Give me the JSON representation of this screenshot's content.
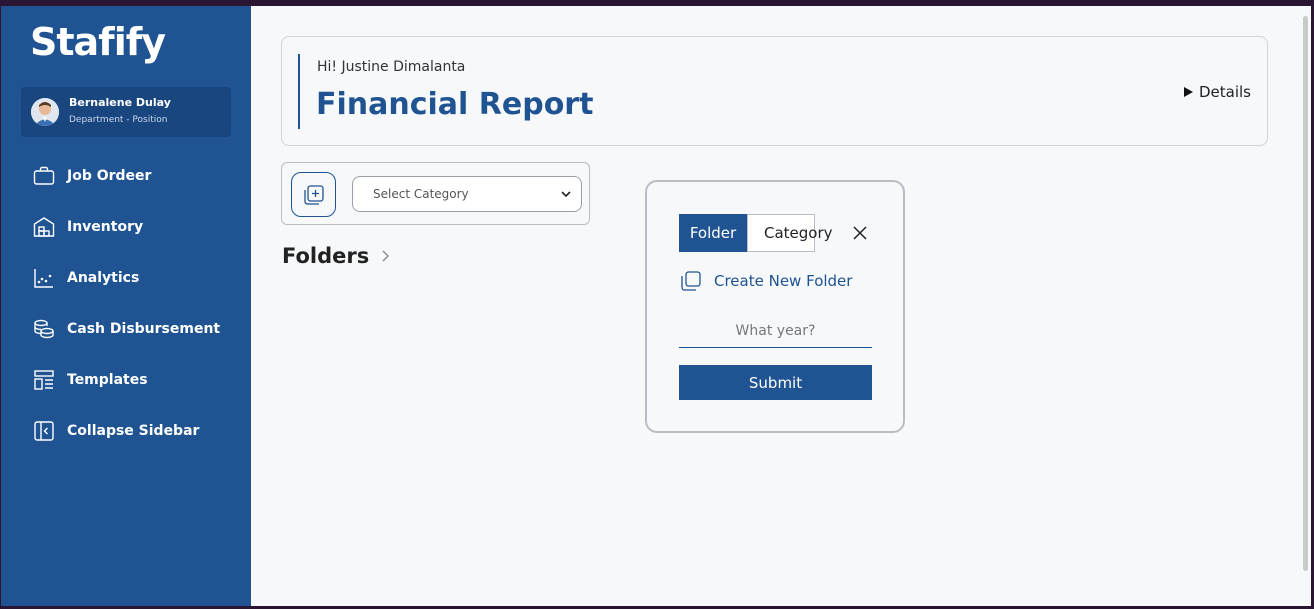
{
  "app": {
    "logo": "Stafify"
  },
  "profile": {
    "name": "Bernalene Dulay",
    "role": "Department - Position"
  },
  "sidebar": {
    "items": [
      {
        "label": "Job Ordeer",
        "icon": "briefcase-icon"
      },
      {
        "label": "Inventory",
        "icon": "warehouse-icon"
      },
      {
        "label": "Analytics",
        "icon": "chart-icon"
      },
      {
        "label": "Cash Disbursement",
        "icon": "coins-icon"
      },
      {
        "label": "Templates",
        "icon": "templates-icon"
      },
      {
        "label": "Collapse Sidebar",
        "icon": "collapse-icon"
      }
    ]
  },
  "header": {
    "greeting": "Hi! Justine Dimalanta",
    "title": "Financial Report",
    "details_label": "Details"
  },
  "toolbar": {
    "category_placeholder": "Select Category"
  },
  "main": {
    "folders_title": "Folders"
  },
  "modal": {
    "tab_folder": "Folder",
    "tab_category": "Category",
    "create_folder_label": "Create New Folder",
    "year_placeholder": "What year?",
    "submit_label": "Submit"
  },
  "colors": {
    "primary": "#1f5392",
    "sidebar": "#1f5392",
    "background": "#f6f8fa"
  }
}
